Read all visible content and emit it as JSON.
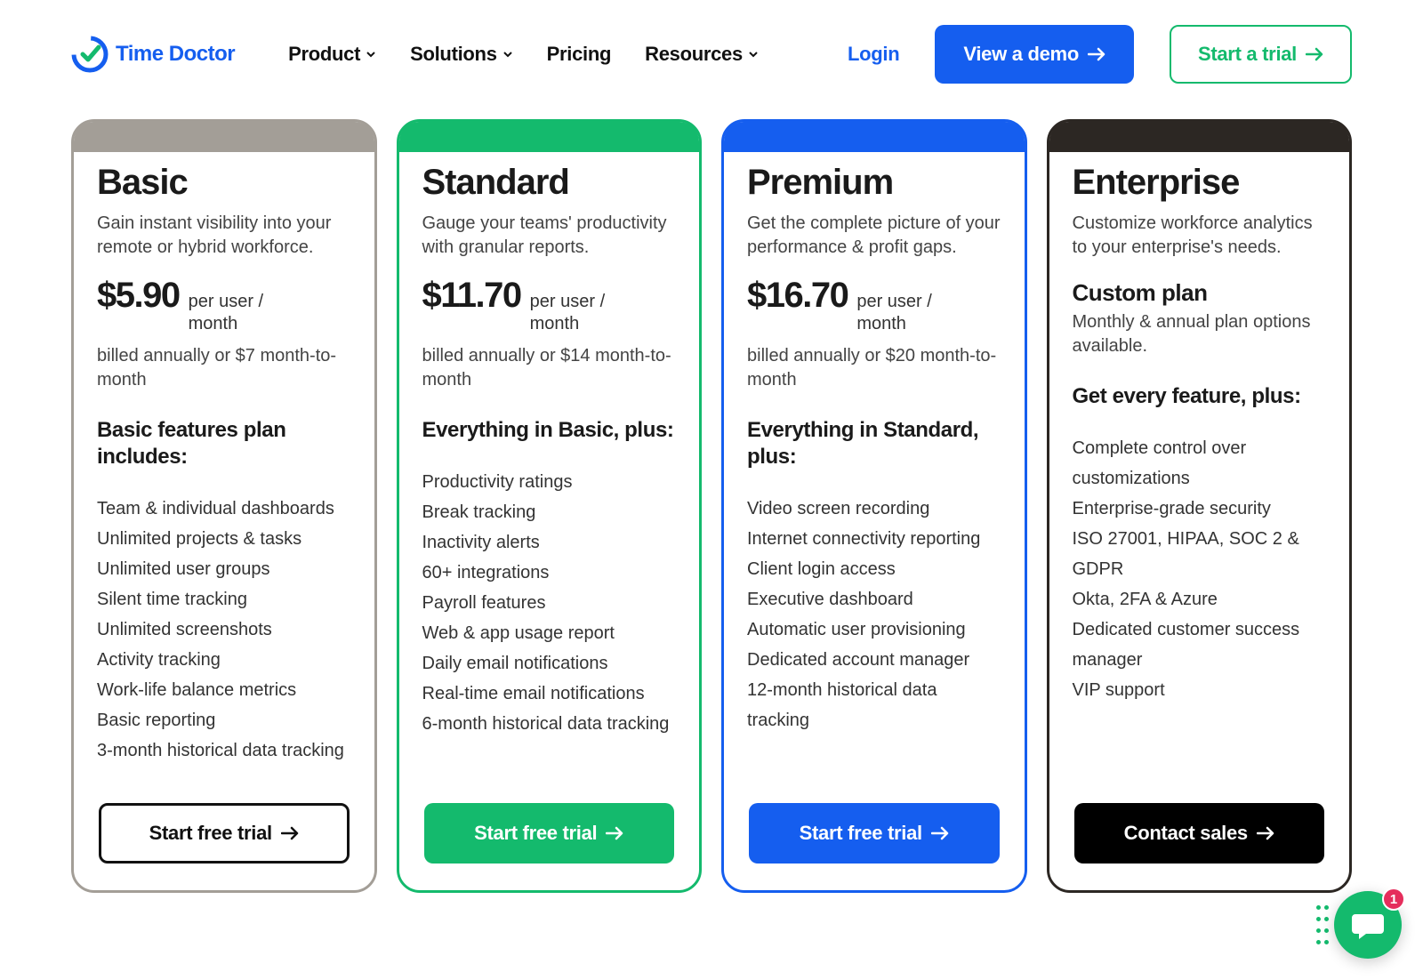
{
  "brand": "Time Doctor",
  "nav": {
    "product": "Product",
    "solutions": "Solutions",
    "pricing": "Pricing",
    "resources": "Resources"
  },
  "header_actions": {
    "login": "Login",
    "view_demo": "View a demo",
    "start_trial": "Start a trial"
  },
  "plans": {
    "basic": {
      "name": "Basic",
      "desc": "Gain instant visibility into your remote or hybrid workforce.",
      "price": "$5.90",
      "price_suffix": "per user / month",
      "billed": "billed annually or $7 month-to-month",
      "features_head": "Basic features plan includes:",
      "features": [
        "Team & individual dashboards",
        "Unlimited projects & tasks",
        "Unlimited user groups",
        "Silent time tracking",
        "Unlimited screenshots",
        "Activity tracking",
        "Work-life balance metrics",
        "Basic reporting",
        "3-month historical data tracking"
      ],
      "cta": "Start free trial"
    },
    "standard": {
      "name": "Standard",
      "desc": "Gauge your teams' productivity with granular reports.",
      "price": "$11.70",
      "price_suffix": "per user / month",
      "billed": "billed annually or $14 month-to-month",
      "features_head": "Everything in Basic, plus:",
      "features": [
        "Productivity ratings",
        "Break tracking",
        "Inactivity alerts",
        "60+ integrations",
        "Payroll features",
        "Web & app usage report",
        "Daily email notifications",
        "Real-time email notifications",
        "6-month historical data tracking"
      ],
      "cta": "Start free trial"
    },
    "premium": {
      "name": "Premium",
      "desc": "Get the complete picture of your performance & profit gaps.",
      "price": "$16.70",
      "price_suffix": "per user / month",
      "billed": "billed annually or $20 month-to-month",
      "features_head": "Everything in Standard, plus:",
      "features": [
        "Video screen recording",
        "Internet connectivity reporting",
        "Client login access",
        "Executive dashboard",
        "Automatic user provisioning",
        "Dedicated account manager",
        "12-month historical data tracking"
      ],
      "cta": "Start free trial"
    },
    "enterprise": {
      "name": "Enterprise",
      "desc": "Customize workforce analytics to your enterprise's needs.",
      "custom_plan_head": "Custom plan",
      "custom_plan_sub": "Monthly & annual plan options available.",
      "features_head": "Get every feature, plus:",
      "features": [
        "Complete control over customizations",
        "Enterprise-grade security",
        "ISO 27001, HIPAA, SOC 2 & GDPR",
        "Okta, 2FA & Azure",
        "Dedicated customer success manager",
        "VIP support"
      ],
      "cta": "Contact sales"
    }
  },
  "chat": {
    "badge": "1"
  }
}
